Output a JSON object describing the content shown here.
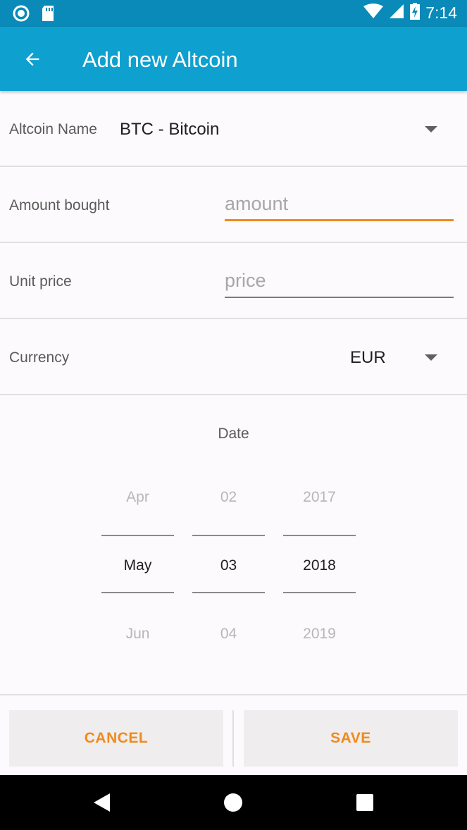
{
  "status_bar": {
    "time": "7:14",
    "icons": [
      "sync-icon",
      "sd-card-icon",
      "wifi-icon",
      "signal-icon",
      "battery-charging-icon"
    ]
  },
  "app_bar": {
    "title": "Add new Altcoin",
    "back_icon": "arrow-back-icon"
  },
  "form": {
    "altcoin": {
      "label": "Altcoin Name",
      "value": "BTC - Bitcoin"
    },
    "amount": {
      "label": "Amount bought",
      "placeholder": "amount"
    },
    "unit_price": {
      "label": "Unit price",
      "placeholder": "price"
    },
    "currency": {
      "label": "Currency",
      "value": "EUR"
    }
  },
  "date": {
    "title": "Date",
    "month": {
      "prev": "Apr",
      "selected": "May",
      "next": "Jun"
    },
    "day": {
      "prev": "02",
      "selected": "03",
      "next": "04"
    },
    "year": {
      "prev": "2017",
      "selected": "2018",
      "next": "2019"
    }
  },
  "buttons": {
    "cancel": "CANCEL",
    "save": "SAVE"
  },
  "colors": {
    "app_bar": "#0ea0cf",
    "status_bar": "#0a8ab8",
    "accent": "#f08a1c"
  },
  "nav_bar": {
    "icons": [
      "back-triangle-icon",
      "home-circle-icon",
      "recents-square-icon"
    ]
  }
}
